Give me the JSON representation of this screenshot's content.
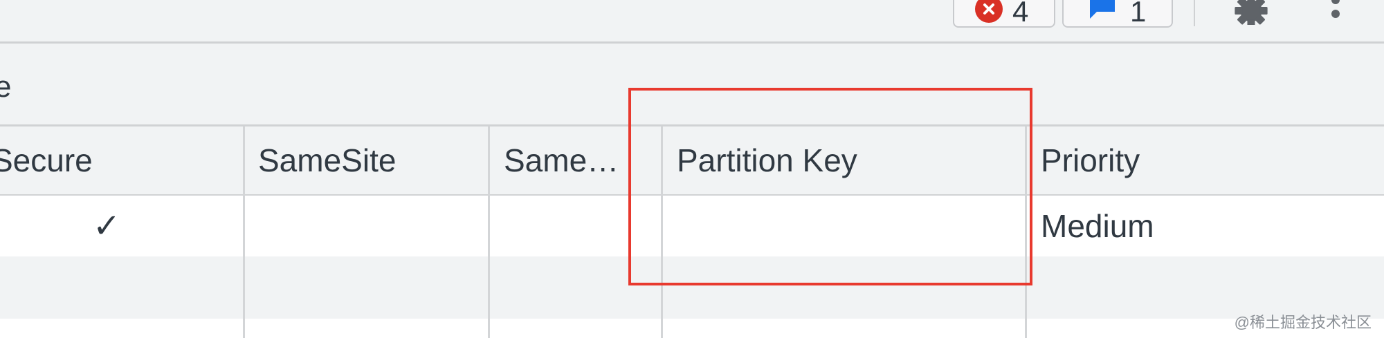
{
  "toolbar": {
    "error_count": "4",
    "message_count": "1",
    "icons": [
      "error-icon",
      "message-icon",
      "gear-icon",
      "more-vert-icon"
    ],
    "colors": {
      "error": "#d93025",
      "message": "#1a73e8"
    }
  },
  "filter": {
    "visible_text": "e"
  },
  "table": {
    "columns": [
      "Secure",
      "SameSite",
      "Same…",
      "Partition Key",
      "Priority"
    ],
    "rows": [
      {
        "secure": "✓",
        "samesite": "",
        "samesite2": "",
        "partition_key": "",
        "priority": "Medium"
      },
      {
        "secure": "",
        "samesite": "",
        "samesite2": "",
        "partition_key": "",
        "priority": ""
      }
    ]
  },
  "annotation": {
    "color": "#e8392e"
  },
  "watermark": "@稀土掘金技术社区"
}
